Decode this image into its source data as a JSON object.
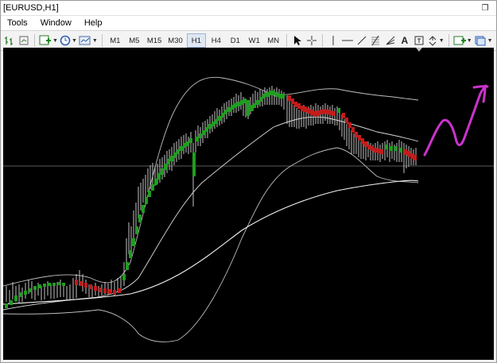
{
  "window": {
    "title": "[EURUSD,H1]",
    "restore_icon": "restore-icon"
  },
  "menu": {
    "items": [
      "Tools",
      "Window",
      "Help"
    ]
  },
  "toolbar": {
    "periods": [
      "M1",
      "M5",
      "M15",
      "M30",
      "H1",
      "H4",
      "D1",
      "W1",
      "MN"
    ],
    "active_period": "H1",
    "text_tool_label": "A",
    "icons": [
      "bar-chart-icon",
      "new-chart-icon",
      "clock-icon",
      "templates-icon",
      "cursor-icon",
      "crosshair-icon",
      "vertical-line-icon",
      "horizontal-line-icon",
      "trendline-icon",
      "fibonacci-icon",
      "text-icon",
      "label-icon",
      "arrows-icon",
      "zoom-in-icon",
      "profiles-icon"
    ]
  },
  "colors": {
    "chart_bg": "#000000",
    "up_candles": "#1f9e1f",
    "down_candles": "#c21b1b",
    "bars": "#d9d9d9",
    "annotation": "#cc33cc"
  }
}
